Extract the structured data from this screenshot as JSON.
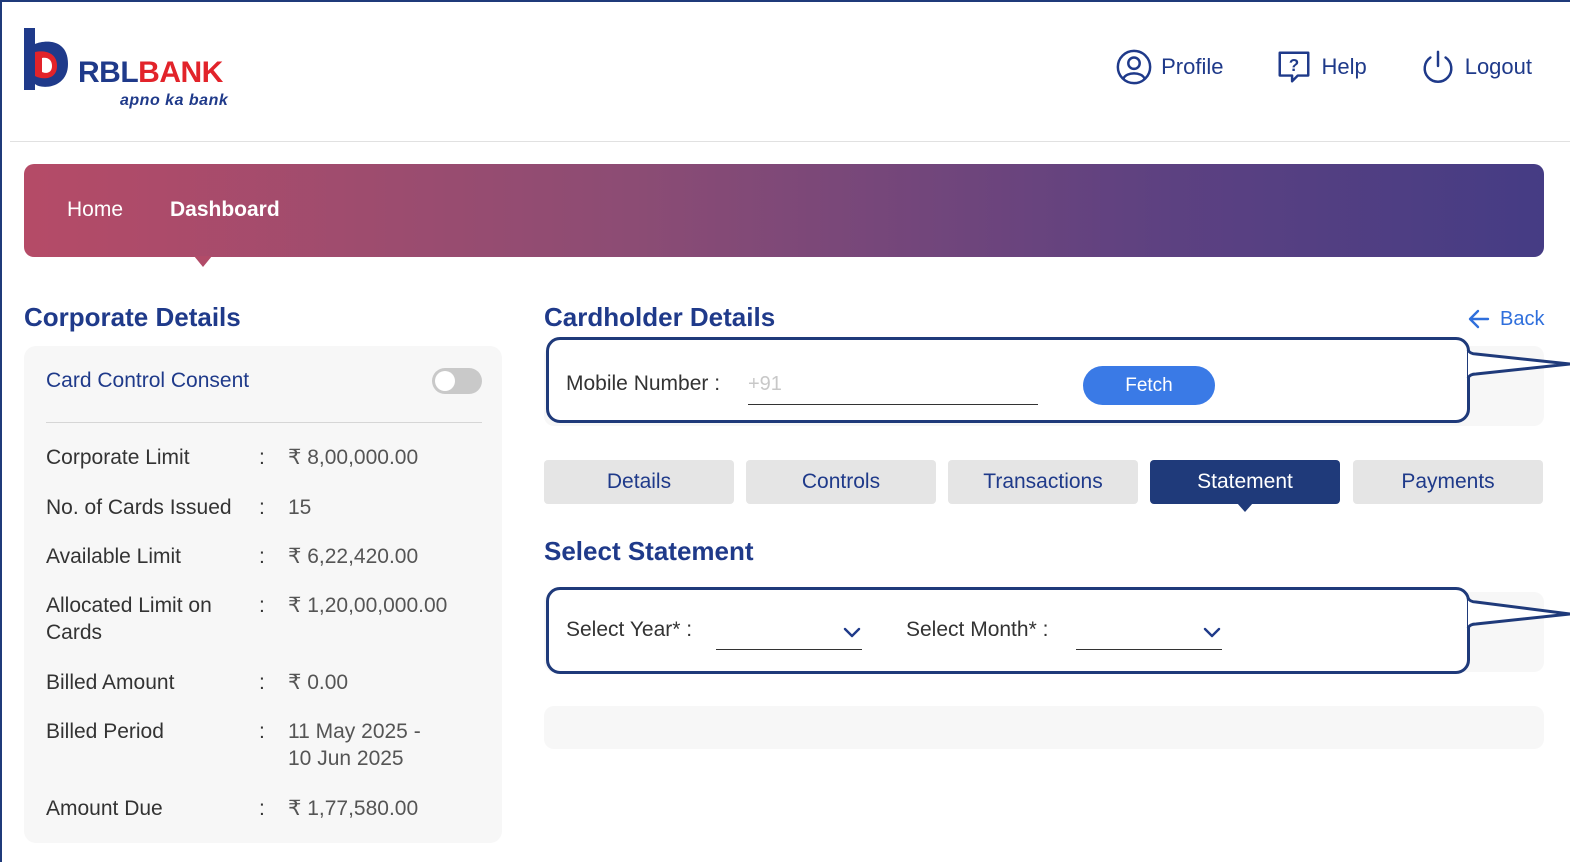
{
  "brand": {
    "name_part1": "RBL",
    "name_part2": "BANK",
    "tagline": "apno ka bank",
    "colors": {
      "primary": "#1f3a8a",
      "accent": "#e2232a"
    }
  },
  "top_nav": {
    "profile": {
      "label": "Profile",
      "icon": "profile-icon"
    },
    "help": {
      "label": "Help",
      "icon": "help-icon"
    },
    "logout": {
      "label": "Logout",
      "icon": "power-icon"
    }
  },
  "breadcrumb": {
    "home": "Home",
    "current": "Dashboard"
  },
  "corporate": {
    "title": "Corporate Details",
    "consent_label": "Card Control Consent",
    "consent_enabled": false,
    "rows": [
      {
        "label": "Corporate Limit",
        "value": "₹ 8,00,000.00"
      },
      {
        "label": "No. of Cards Issued",
        "value": "15"
      },
      {
        "label": "Available Limit",
        "value": "₹ 6,22,420.00"
      },
      {
        "label": "Allocated Limit on Cards",
        "value": "₹ 1,20,00,000.00"
      },
      {
        "label": "Billed Amount",
        "value": "₹ 0.00"
      },
      {
        "label": "Billed Period",
        "value": "11 May 2025 - 10 Jun 2025"
      },
      {
        "label": "Amount Due",
        "value": "₹ 1,77,580.00"
      }
    ]
  },
  "cardholder": {
    "title": "Cardholder Details",
    "back_label": "Back",
    "mobile_label": "Mobile Number :",
    "mobile_placeholder": "+91",
    "mobile_value": "",
    "fetch_label": "Fetch"
  },
  "tabs": [
    {
      "label": "Details",
      "active": false
    },
    {
      "label": "Controls",
      "active": false
    },
    {
      "label": "Transactions",
      "active": false
    },
    {
      "label": "Statement",
      "active": true
    },
    {
      "label": "Payments",
      "active": false
    }
  ],
  "statement": {
    "title": "Select Statement",
    "year_label": "Select Year* :",
    "year_value": "",
    "month_label": "Select Month* :",
    "month_value": ""
  }
}
